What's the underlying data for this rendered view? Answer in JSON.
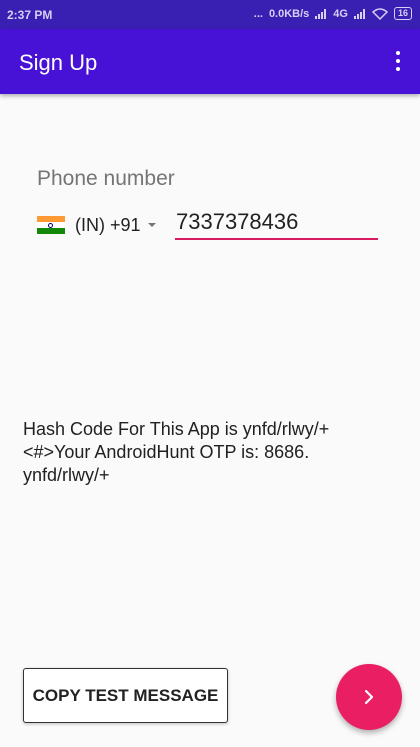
{
  "status_bar": {
    "time": "2:37 PM",
    "dots": "...",
    "network_speed": "0.0KB/s",
    "network_type": "4G",
    "battery": "16"
  },
  "app_bar": {
    "title": "Sign Up",
    "menu_icon": "more-vert-icon"
  },
  "form": {
    "phone_label": "Phone number",
    "country": {
      "flag_icon": "india-flag-icon",
      "code_text": "(IN) +91"
    },
    "phone_number": "7337378436"
  },
  "hash_info": {
    "lines": [
      "Hash Code For This App is  ynfd/rlwy/+",
      "<#>Your AndroidHunt OTP is: 8686.",
      "ynfd/rlwy/+"
    ]
  },
  "actions": {
    "copy_button_label": "COPY TEST MESSAGE",
    "next_icon": "chevron-right-icon"
  },
  "colors": {
    "status_bar": "#3a1fb3",
    "app_bar": "#4812d6",
    "accent": "#e91e63"
  }
}
